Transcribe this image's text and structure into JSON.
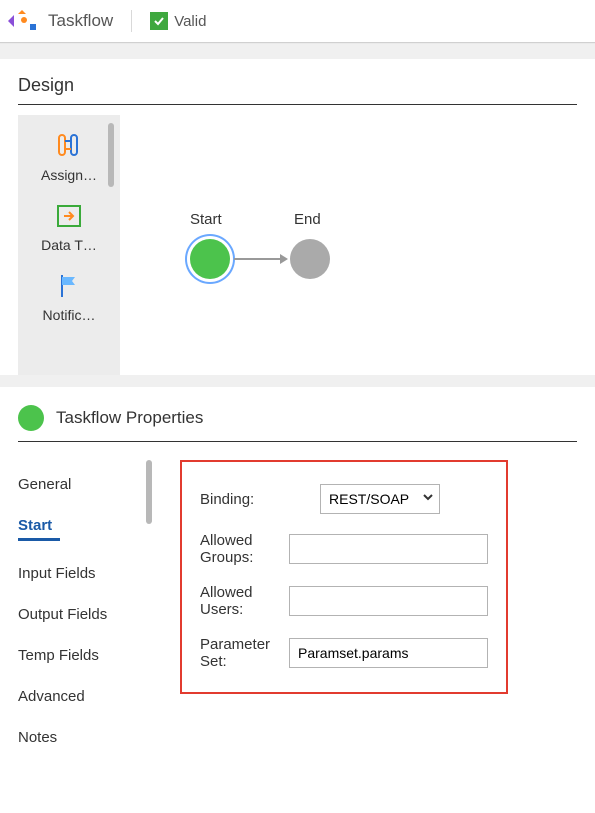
{
  "header": {
    "app_title": "Taskflow",
    "valid_label": "Valid"
  },
  "design": {
    "title": "Design",
    "palette": [
      {
        "id": "assignment",
        "label": "Assign…"
      },
      {
        "id": "data-task",
        "label": "Data T…"
      },
      {
        "id": "notification",
        "label": "Notific…"
      }
    ],
    "nodes": {
      "start_label": "Start",
      "end_label": "End"
    }
  },
  "properties": {
    "title": "Taskflow Properties",
    "tabs": [
      "General",
      "Start",
      "Input Fields",
      "Output Fields",
      "Temp Fields",
      "Advanced",
      "Notes"
    ],
    "active_tab": "Start",
    "form": {
      "binding_label": "Binding:",
      "binding_value": "REST/SOAP",
      "allowed_groups_label": "Allowed Groups:",
      "allowed_groups_value": "",
      "allowed_users_label": "Allowed Users:",
      "allowed_users_value": "",
      "parameter_set_label": "Parameter Set:",
      "parameter_set_value": "Paramset.params"
    }
  }
}
